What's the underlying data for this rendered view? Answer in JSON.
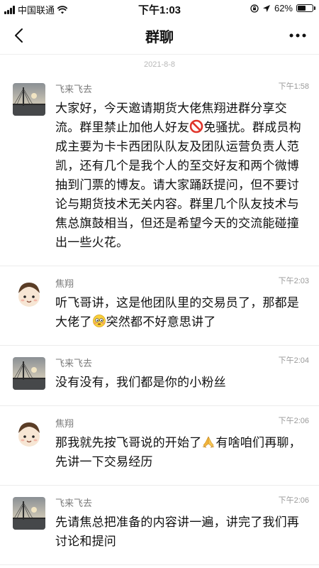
{
  "status": {
    "carrier": "中国联通",
    "time": "下午1:03",
    "battery": "62%",
    "battery_level": 0.62
  },
  "nav": {
    "title": "群聊",
    "back_icon": "chevron-left-icon",
    "more_icon": "more-dots-icon"
  },
  "date_separator": "2021-8-8",
  "messages": [
    {
      "sender": "飞来飞去",
      "time": "下午1:58",
      "avatar": "bridge-photo-avatar",
      "text_a": "大家好，今天邀请期货大佬焦翔进群分享交流。群里禁止加他人好友",
      "emoji": "no-entry-icon",
      "text_b": "免骚扰。群成员构成主要为卡卡西团队队友及团队运营负责人范凯，还有几个是我个人的至交好友和两个微博抽到门票的博友。请大家踊跃提问，但不要讨论与期货技术无关内容。群里几个队友技术与焦总旗鼓相当，但还是希望今天的交流能碰撞出一些火花。"
    },
    {
      "sender": "焦翔",
      "time": "下午2:03",
      "avatar": "cartoon-face-avatar",
      "text_a": "听飞哥讲，这是他团队里的交易员了，那都是大佬了",
      "emoji": "embarrassed-face-icon",
      "text_b": "突然都不好意思讲了"
    },
    {
      "sender": "飞来飞去",
      "time": "下午2:04",
      "avatar": "bridge-photo-avatar",
      "text_a": "没有没有，我们都是你的小粉丝"
    },
    {
      "sender": "焦翔",
      "time": "下午2:06",
      "avatar": "cartoon-face-avatar",
      "text_a": "那我就先按飞哥说的开始了",
      "emoji": "folded-hands-icon",
      "text_b": "有啥咱们再聊，先讲一下交易经历"
    },
    {
      "sender": "飞来飞去",
      "time": "下午2:06",
      "avatar": "bridge-photo-avatar",
      "text_a": "先请焦总把准备的内容讲一遍，讲完了我们再讨论和提问"
    }
  ]
}
